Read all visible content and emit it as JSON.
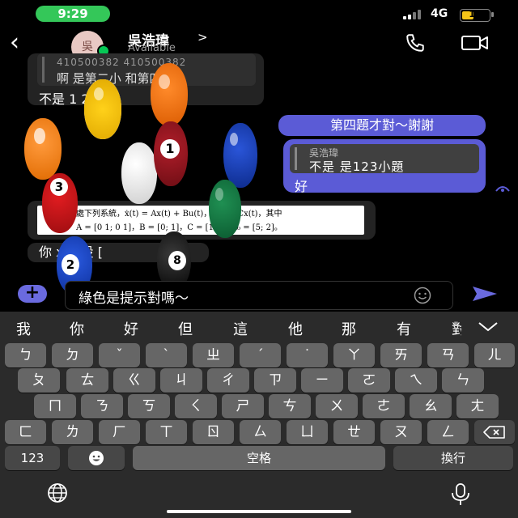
{
  "status_bar": {
    "time": "9:29",
    "network": "4G",
    "battery": "17"
  },
  "header": {
    "back_icon": "chevron-left-icon",
    "avatar_text": "吳",
    "contact_name": "吳浩瑋",
    "contact_chevron": ">",
    "contact_status": "Available",
    "call_icon": "phone-icon",
    "video_icon": "video-camera-icon",
    "presence_color": "#06c755"
  },
  "messages": [
    {
      "side": "left",
      "reply_name": "410500382 410500382",
      "reply_text": "啊 是第二小 和第四",
      "text": "不是 1 2 小題"
    },
    {
      "side": "right",
      "text": "第四題才對～謝謝"
    },
    {
      "side": "right",
      "reply_name": "吳浩瑋",
      "reply_text": "不是 是123小題",
      "text": "好"
    },
    {
      "side": "left",
      "image_line1": "處下列系統，ẋ(t) = Ax(t) + Bu(t)，y(t) = Cx(t)，其中",
      "image_line2": "A = [0 1; 0 1]，B = [0; 1]，C = [1  0]，x₀ = [5; 2]。"
    },
    {
      "side": "left",
      "text": "你   x 是設 ["
    }
  ],
  "composer": {
    "plus_label": "+",
    "input_value": "綠色是提示對嗎～",
    "emoji_icon": "smiley-icon",
    "send_icon": "send-arrow-icon"
  },
  "keyboard": {
    "candidates": [
      "我",
      "你",
      "好",
      "但",
      "這",
      "他",
      "那",
      "有",
      "對"
    ],
    "collapse_icon": "chevron-down-icon",
    "row1": [
      "ㄅ",
      "ㄉ",
      "ˇ",
      "ˋ",
      "ㄓ",
      "ˊ",
      "˙",
      "ㄚ",
      "ㄞ",
      "ㄢ",
      "ㄦ"
    ],
    "row2": [
      "ㄆ",
      "ㄊ",
      "ㄍ",
      "ㄐ",
      "ㄔ",
      "ㄗ",
      "ㄧ",
      "ㄛ",
      "ㄟ",
      "ㄣ"
    ],
    "row3": [
      "ㄇ",
      "ㄋ",
      "ㄎ",
      "ㄑ",
      "ㄕ",
      "ㄘ",
      "ㄨ",
      "ㄜ",
      "ㄠ",
      "ㄤ"
    ],
    "row4": [
      "ㄈ",
      "ㄌ",
      "ㄏ",
      "ㄒ",
      "ㄖ",
      "ㄙ",
      "ㄩ",
      "ㄝ",
      "ㄡ",
      "ㄥ"
    ],
    "delete_icon": "backspace-icon",
    "numbers_label": "123",
    "emoji_key_icon": "emoji-face-icon",
    "space_label": "空格",
    "return_label": "換行",
    "globe_icon": "globe-icon",
    "mic_icon": "microphone-icon"
  },
  "overlay_balls": [
    "3",
    "1",
    "2",
    "8"
  ]
}
